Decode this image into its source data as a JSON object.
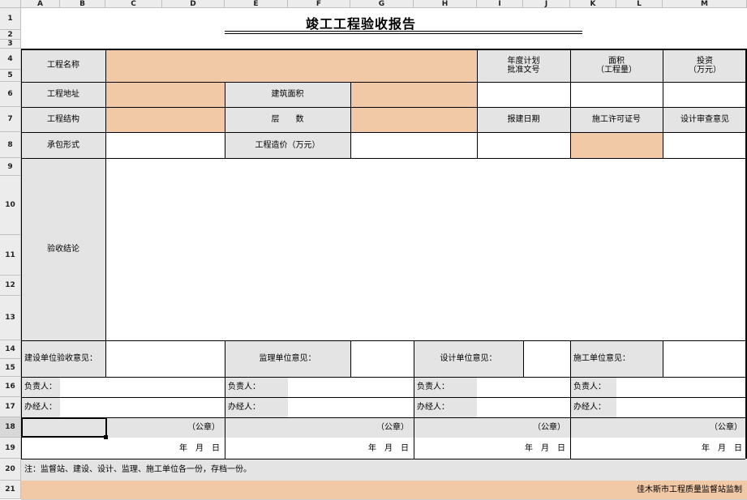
{
  "columns": [
    "A",
    "B",
    "C",
    "D",
    "E",
    "F",
    "G",
    "H",
    "I",
    "J",
    "K",
    "L",
    "M"
  ],
  "rows": [
    "1",
    "2",
    "3",
    "4",
    "5",
    "6",
    "7",
    "8",
    "9",
    "10",
    "11",
    "12",
    "13",
    "14",
    "15",
    "16",
    "17",
    "18",
    "19",
    "20",
    "21"
  ],
  "selected_row": "18",
  "title": "竣工工程验收报告",
  "labels": {
    "project_name": "工程名称",
    "annual_plan": "年度计划\n批准文号",
    "area": "面积\n（工程量）",
    "investment": "投资\n（万元）",
    "project_address": "工程地址",
    "building_area": "建筑面积",
    "project_structure": "工程结构",
    "floors": "层　　数",
    "report_date": "报建日期",
    "construction_permit": "施工许可证号",
    "design_review": "设计审查意见",
    "contract_form": "承包形式",
    "project_cost": "工程造价（万元）",
    "acceptance_conclusion": "验收结论",
    "owner_opinion": "建设单位验收意见：",
    "supervision_opinion": "监理单位意见：",
    "design_opinion": "设计单位意见：",
    "contractor_opinion": "施工单位意见：",
    "person_in_charge": "负责人：",
    "handler": "办经人：",
    "seal": "（公章）",
    "date": "年　月　日",
    "note": "注：监督站、建设、设计、监理、施工单位各一份，存档一份。",
    "footer": "佳木斯市工程质量监督站监制"
  }
}
